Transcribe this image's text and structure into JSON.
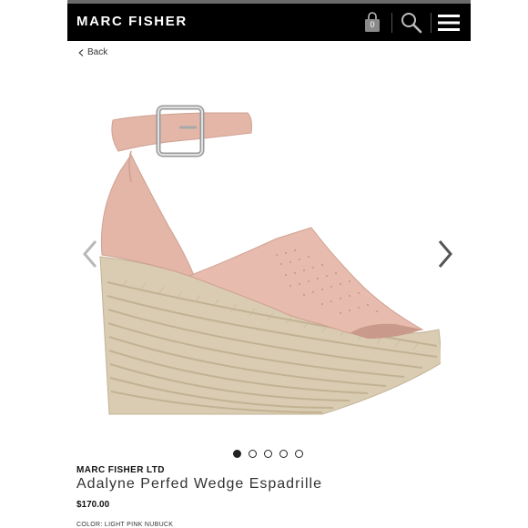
{
  "header": {
    "brand": "MARC FISHER",
    "bag_count": "0"
  },
  "nav": {
    "back_label": "Back"
  },
  "icons": [
    "shopping-bag-icon",
    "search-icon",
    "menu-icon",
    "chevron-left-icon",
    "chevron-right-icon"
  ],
  "carousel": {
    "slide_count": 5,
    "active_index": 0
  },
  "product": {
    "brand": "MARC FISHER LTD",
    "name": "Adalyne Perfed Wedge Espadrille",
    "price": "$170.00",
    "color": "COLOR: LIGHT PINK NUBUCK"
  },
  "colors": {
    "header_bg": "#000000",
    "upper": "#e3b6a8",
    "jute": "#d9ccb2"
  }
}
